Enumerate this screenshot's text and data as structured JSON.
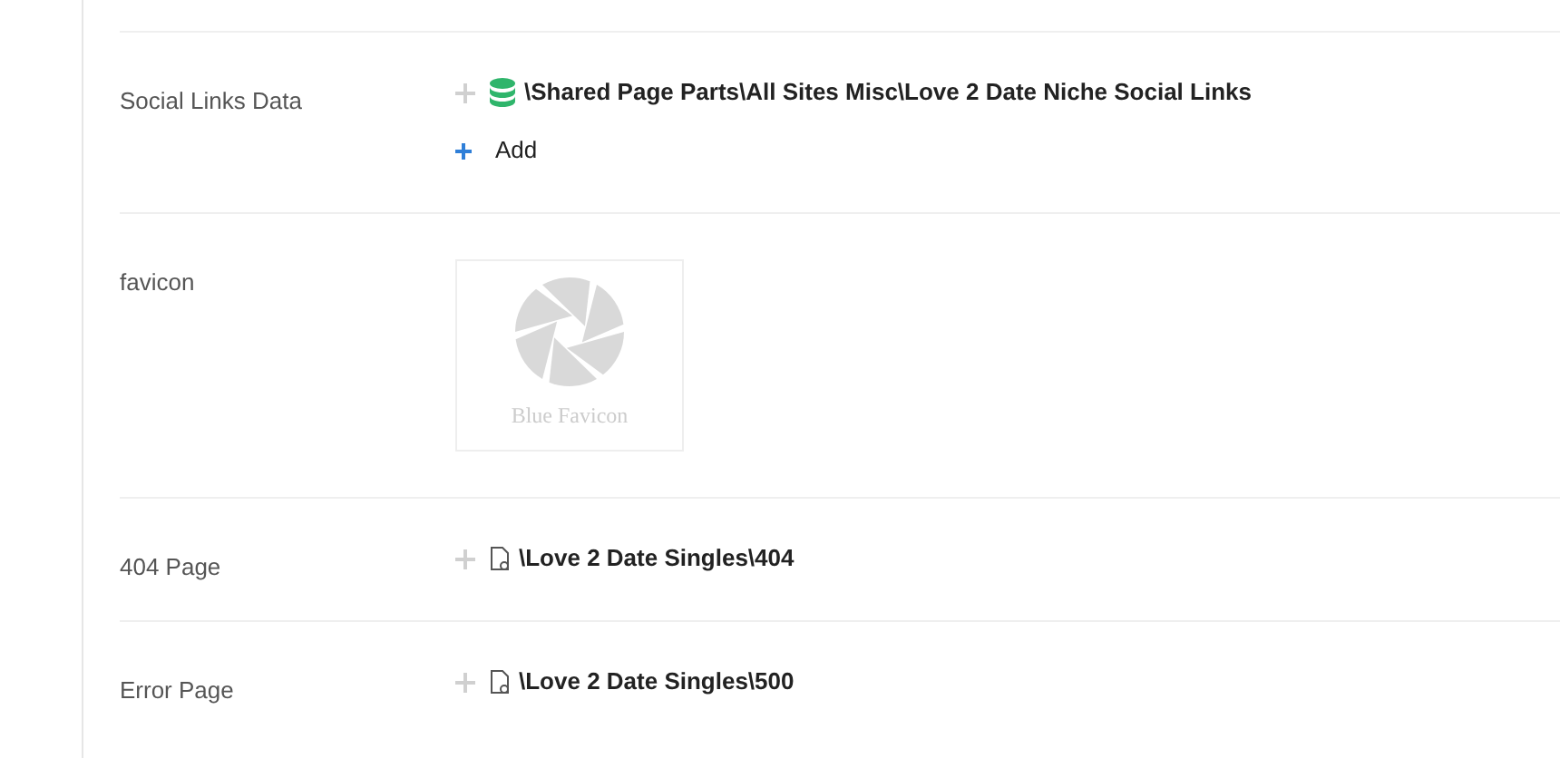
{
  "fields": [
    {
      "kind": "links",
      "label": "Social Links Data",
      "items": [
        {
          "kind": "datasource",
          "path": "\\Shared Page Parts\\All Sites Misc\\Love 2 Date Niche Social Links"
        }
      ],
      "add": "Add"
    },
    {
      "kind": "image",
      "label": "favicon",
      "caption": "Blue Favicon"
    },
    {
      "kind": "links",
      "label": "404 Page",
      "items": [
        {
          "kind": "page",
          "path": "\\Love 2 Date Singles\\404"
        }
      ]
    },
    {
      "kind": "links",
      "label": "Error Page",
      "items": [
        {
          "kind": "page",
          "path": "\\Love 2 Date Singles\\500"
        }
      ]
    }
  ]
}
